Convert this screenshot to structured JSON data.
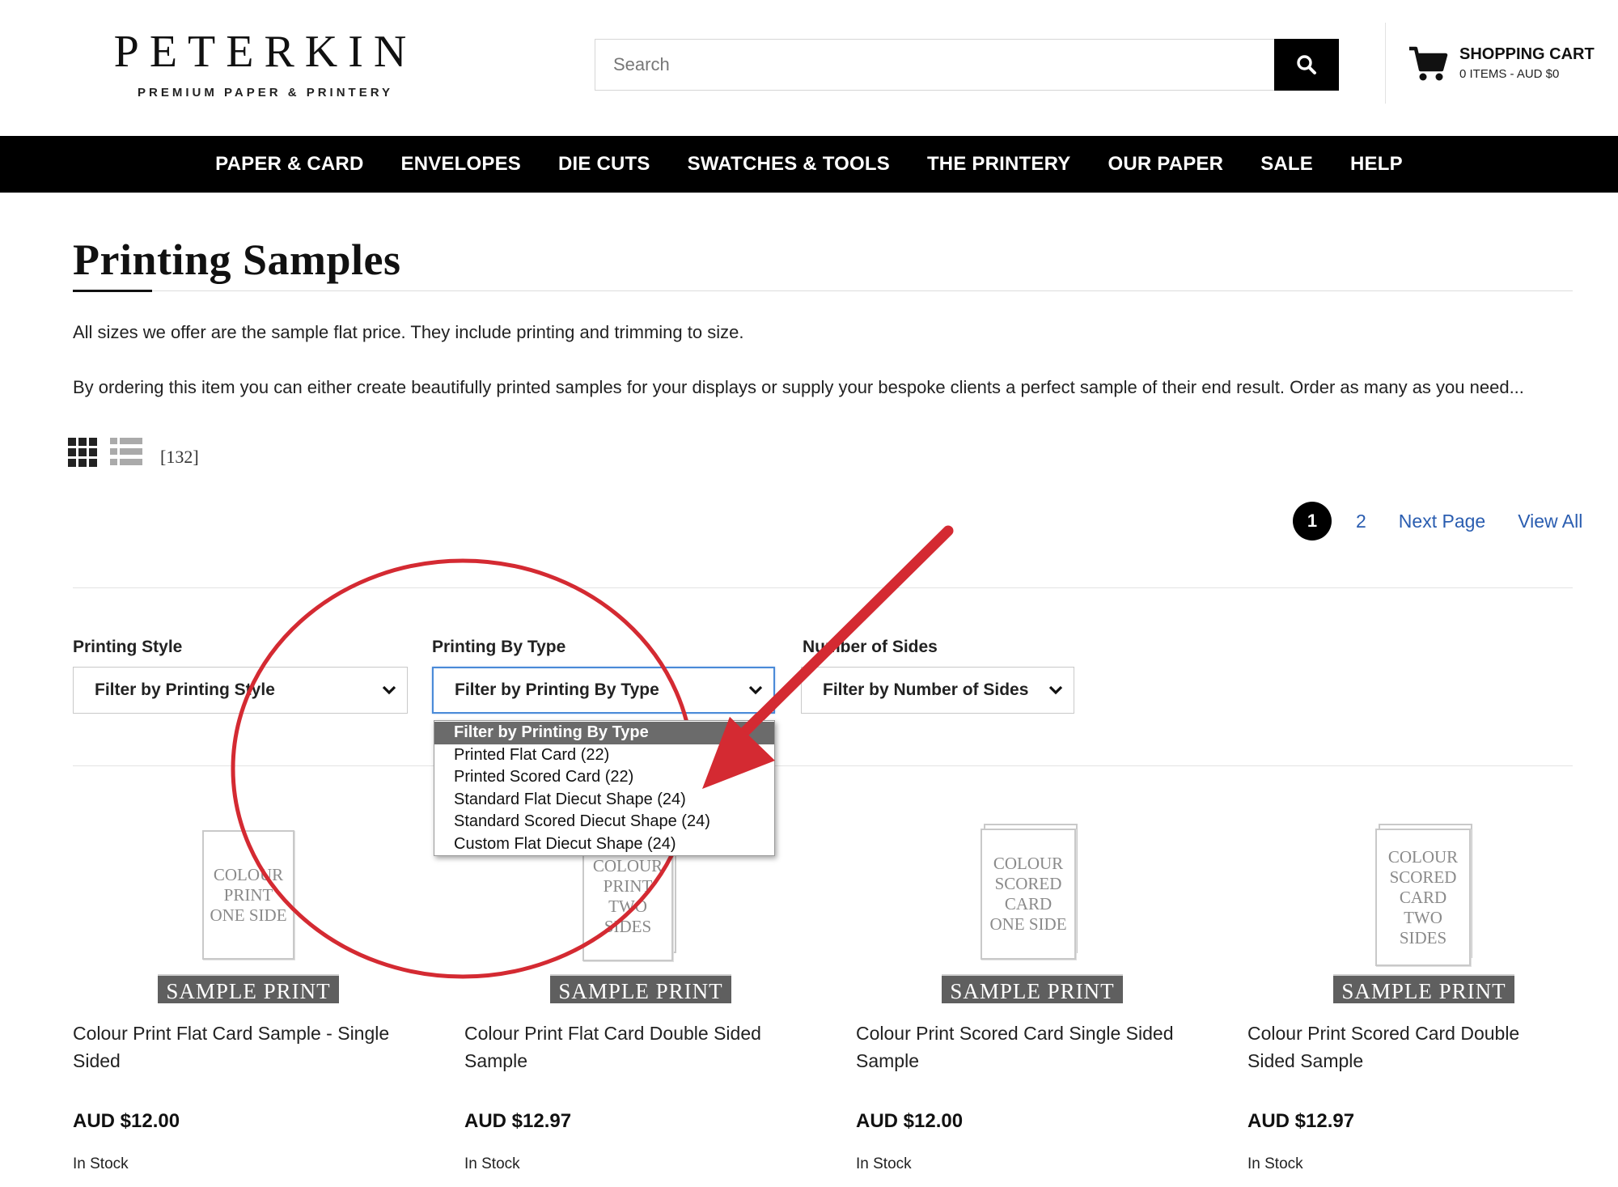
{
  "brand": {
    "name": "PETERKIN",
    "tagline": "PREMIUM PAPER & PRINTERY"
  },
  "search": {
    "placeholder": "Search",
    "button_icon": "search-icon"
  },
  "cart": {
    "title": "SHOPPING CART",
    "summary": "0 ITEMS - AUD $0",
    "icon": "cart-icon"
  },
  "nav": {
    "items": [
      {
        "label": "PAPER & CARD"
      },
      {
        "label": "ENVELOPES"
      },
      {
        "label": "DIE CUTS"
      },
      {
        "label": "SWATCHES & TOOLS"
      },
      {
        "label": "THE PRINTERY"
      },
      {
        "label": "OUR PAPER"
      },
      {
        "label": "SALE"
      },
      {
        "label": "HELP"
      }
    ]
  },
  "page": {
    "title": "Printing Samples",
    "description": [
      "All sizes we offer are the sample flat price. They include printing and trimming to size.",
      "By ordering this item you can either create beautifully printed samples for your displays or supply your bespoke clients a perfect sample of their end result. Order as many as you need..."
    ],
    "result_count": "[132]"
  },
  "pagination": {
    "current": "1",
    "next_number": "2",
    "next_label": "Next Page",
    "view_all": "View All"
  },
  "filters": [
    {
      "label": "Printing Style",
      "value": "Filter by Printing Style"
    },
    {
      "label": "Printing By Type",
      "value": "Filter by Printing By Type"
    },
    {
      "label": "Number of Sides",
      "value": "Filter by Number of Sides"
    }
  ],
  "dropdown": {
    "options": [
      "Filter by Printing By Type",
      "Printed Flat Card (22)",
      "Printed Scored Card (22)",
      "Standard Flat Diecut Shape (24)",
      "Standard Scored Diecut Shape (24)",
      "Custom Flat Diecut Shape (24)"
    ],
    "selected_index": 0
  },
  "products": [
    {
      "thumb_lines": [
        "COLOUR",
        "PRINT",
        "ONE SIDE"
      ],
      "banner": "SAMPLE PRINT",
      "name": "Colour Print Flat Card Sample - Single Sided",
      "price": "AUD $12.00",
      "stock": "In Stock"
    },
    {
      "thumb_lines": [
        "COLOUR",
        "PRINT",
        "TWO",
        "SIDES"
      ],
      "banner": "SAMPLE PRINT",
      "name": "Colour Print Flat Card Double Sided Sample",
      "price": "AUD $12.97",
      "stock": "In Stock"
    },
    {
      "thumb_lines": [
        "COLOUR",
        "SCORED",
        "CARD",
        "ONE SIDE"
      ],
      "banner": "SAMPLE PRINT",
      "name": "Colour Print Scored Card Single Sided Sample",
      "price": "AUD $12.00",
      "stock": "In Stock"
    },
    {
      "thumb_lines": [
        "COLOUR",
        "SCORED",
        "CARD",
        "TWO",
        "SIDES"
      ],
      "banner": "SAMPLE PRINT",
      "name": "Colour Print Scored Card Double Sided Sample",
      "price": "AUD $12.97",
      "stock": "In Stock"
    }
  ],
  "colors": {
    "nav_bg": "#000000",
    "link": "#2a5db0",
    "annotation": "#d42a32",
    "dropdown_selected": "#6b6b6b",
    "focus_border": "#4a8ad8"
  }
}
